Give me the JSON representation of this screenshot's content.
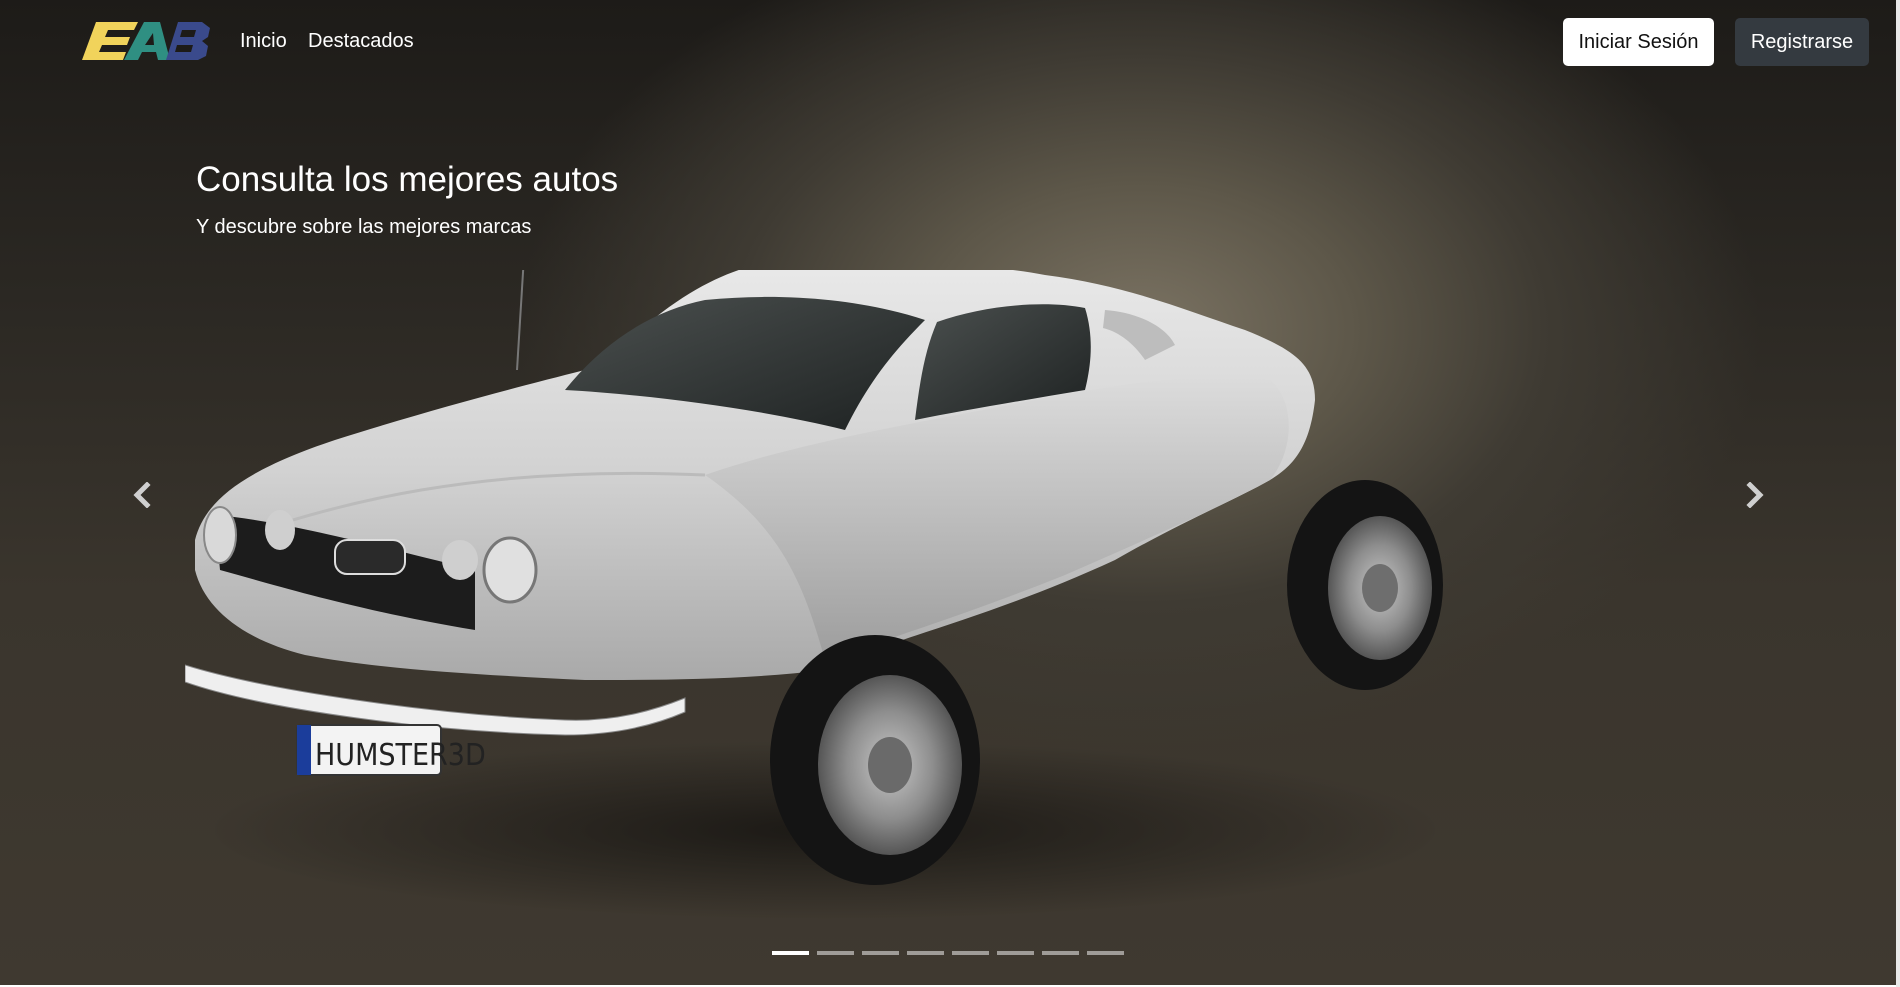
{
  "brand": {
    "logo_text": "EAB",
    "colors": {
      "e": "#f1d35b",
      "a": "#2f8f82",
      "b": "#3a4a8c"
    }
  },
  "nav": {
    "links": [
      {
        "label": "Inicio"
      },
      {
        "label": "Destacados"
      }
    ],
    "login_label": "Iniciar Sesión",
    "register_label": "Registrarse"
  },
  "carousel": {
    "title": "Consulta los mejores autos",
    "subtitle": "Y descubre sobre las mejores marcas",
    "plate_text": "HUMSTER3D",
    "prev_icon": "chevron-left-icon",
    "next_icon": "chevron-right-icon",
    "slide_count": 8,
    "active_slide": 1
  },
  "colors": {
    "register_bg": "#343a40",
    "login_bg": "#ffffff"
  }
}
